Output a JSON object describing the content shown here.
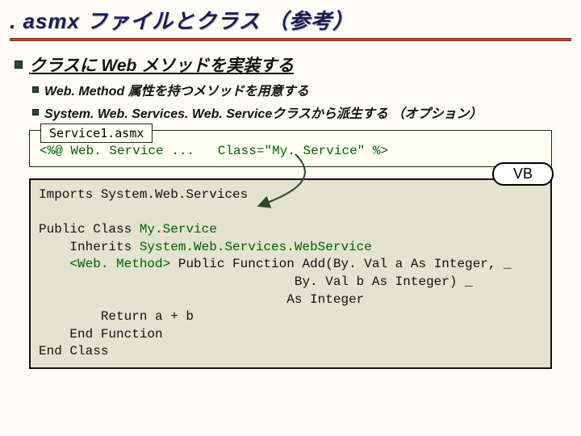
{
  "slide": {
    "title": ". asmx ファイルとクラス （参考）",
    "section_heading": "クラスに Web メソッドを実装する",
    "bullets": [
      "Web. Method 属性を持つメソッドを用意する",
      "System. Web. Services. Web. Serviceクラスから派生する （オプション）"
    ],
    "file_tab": "Service1.asmx",
    "directive_prefix": "<%@ Web. Service ...   ",
    "directive_class_kw": "Class",
    "directive_class_val": "=\"My. Service\"",
    "directive_suffix": " %>",
    "vb_label": "VB",
    "code": {
      "l1": "Imports System.Web.Services",
      "l2": "",
      "l3a": "Public Class ",
      "l3b": "My.Service",
      "l4a": "    Inherits ",
      "l4b": "System.Web.Services.WebService",
      "l5a": "    ",
      "l5b": "<Web. Method>",
      "l5c": " Public Function Add(By. Val a As Integer, _",
      "l6": "                                 By. Val b As Integer) _",
      "l7": "                                As Integer",
      "l8": "        Return a + b",
      "l9": "    End Function",
      "l10": "End Class"
    }
  },
  "icons": {
    "bullet_square": "square-icon"
  }
}
